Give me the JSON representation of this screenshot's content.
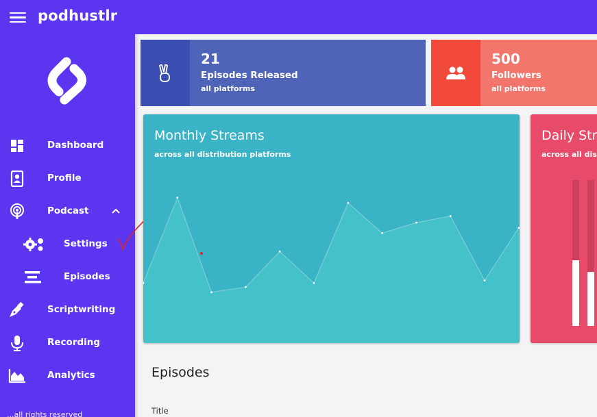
{
  "app": {
    "title": "podhustlr"
  },
  "sidebar": {
    "items": [
      {
        "label": "Dashboard",
        "icon": "dashboard-icon"
      },
      {
        "label": "Profile",
        "icon": "profile-icon"
      },
      {
        "label": "Podcast",
        "icon": "podcast-icon",
        "expanded": true
      },
      {
        "label": "Settings",
        "icon": "gears-icon"
      },
      {
        "label": "Episodes",
        "icon": "list-icon"
      },
      {
        "label": "Scriptwriting",
        "icon": "pen-icon"
      },
      {
        "label": "Recording",
        "icon": "microphone-icon"
      },
      {
        "label": "Analytics",
        "icon": "area-chart-icon"
      }
    ],
    "footer": "...all rights reserved"
  },
  "stats": [
    {
      "value": "21",
      "title": "Episodes Released",
      "sub": "all platforms",
      "icon": "peace-hand-icon",
      "icon_bg": "#3b4fb3",
      "bg": "#4f63b8"
    },
    {
      "value": "500",
      "title": "Followers",
      "sub": "all platforms",
      "icon": "users-icon",
      "icon_bg": "#f24a3a",
      "bg": "#f2766c"
    }
  ],
  "cards": {
    "monthly": {
      "title": "Monthly Streams",
      "sub": "across all distribution platforms",
      "bg": "#3ab3c6",
      "fill": "#45c2c9"
    },
    "daily": {
      "title": "Daily Streams",
      "sub": "across all distribution platforms",
      "bg": "#e84a6a"
    }
  },
  "chart_data": [
    {
      "type": "area",
      "title": "Monthly Streams",
      "subtitle": "across all distribution platforms",
      "x": [
        1,
        2,
        3,
        4,
        5,
        6,
        7,
        8,
        9,
        10,
        11,
        12
      ],
      "values": [
        30,
        95,
        23,
        27,
        54,
        30,
        91,
        68,
        76,
        81,
        32,
        72
      ],
      "ylim": [
        0,
        100
      ],
      "grid": false
    },
    {
      "type": "bar",
      "title": "Daily Streams",
      "subtitle": "across all distribution platforms",
      "values": [
        45,
        37
      ],
      "ylim": [
        0,
        100
      ],
      "grid": false
    }
  ],
  "main": {
    "section_title": "Episodes",
    "table": {
      "columns": [
        "Title"
      ]
    }
  }
}
